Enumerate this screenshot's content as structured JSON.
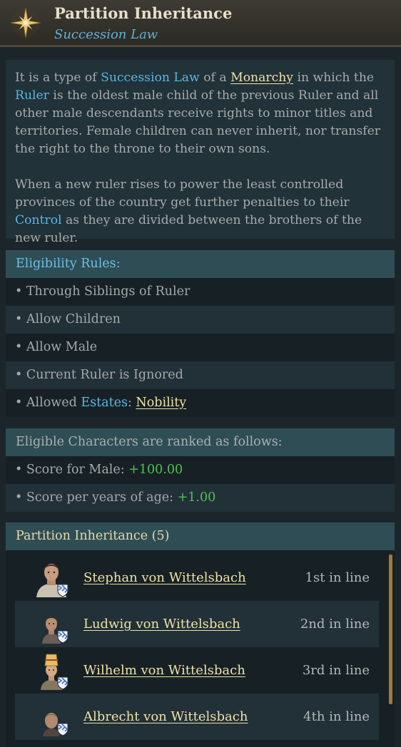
{
  "header": {
    "title": "Partition Inheritance",
    "subtitle": "Succession Law",
    "icon": "compass-star-icon"
  },
  "description": {
    "p1": {
      "t1": "It is a type of ",
      "k1": "Succession Law",
      "t2": " of a ",
      "k2": "Monarchy",
      "t3": " in which the ",
      "k3": "Ruler",
      "t4": " is the oldest male child of the previous Ruler and all other male descendants receive rights to minor titles and territories. Female children can never inherit, nor transfer the right to the throne to their own sons."
    },
    "p2": {
      "t1": "When a new ruler rises to power the least controlled provinces of the country get further penalties to their ",
      "k1": "Control",
      "t2": " as they are divided between the brothers of the new ruler."
    }
  },
  "eligibility": {
    "header": "Eligibility Rules:",
    "rules": [
      "• Through Siblings of Ruler",
      "• Allow Children",
      "• Allow Male",
      "• Current Ruler is Ignored"
    ],
    "estates": {
      "prefix": "• Allowed ",
      "label": "Estates",
      "colon": ": ",
      "value": "Nobility"
    }
  },
  "ranking": {
    "header": "Eligible Characters are ranked as follows:",
    "items": [
      {
        "label": "• Score for Male: ",
        "value": "+100.00"
      },
      {
        "label": "• Score per years of age: ",
        "value": "+1.00"
      }
    ]
  },
  "heirs": {
    "header": "Partition Inheritance (5)",
    "characters": [
      {
        "name": "Stephan von Wittelsbach",
        "rank": "1st in line",
        "portrait": "portrait-icon"
      },
      {
        "name": "Ludwig von Wittelsbach",
        "rank": "2nd in line",
        "portrait": "portrait-icon"
      },
      {
        "name": "Wilhelm von Wittelsbach",
        "rank": "3rd in line",
        "portrait": "portrait-icon"
      },
      {
        "name": "Albrecht von Wittelsbach",
        "rank": "4th in line",
        "portrait": "portrait-icon"
      }
    ]
  },
  "colors": {
    "keyword": "#5ab7e2",
    "link": "#f0e2a5",
    "positive": "#4ec156",
    "section_header": "#2f4d55",
    "scrollbar": "#a07a3c"
  }
}
